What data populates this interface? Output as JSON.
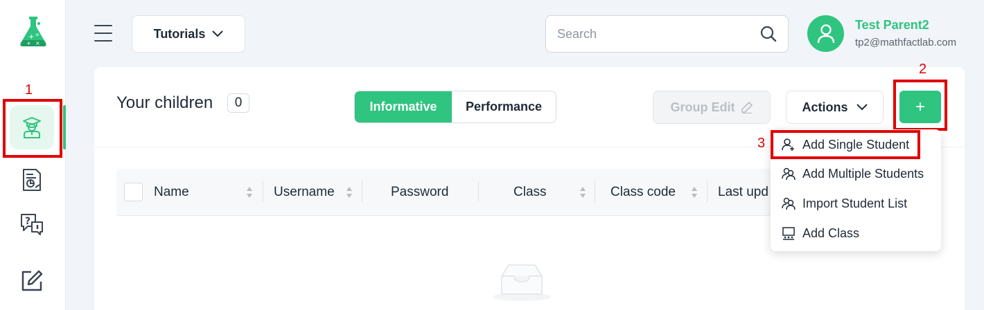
{
  "header": {
    "tutorials_label": "Tutorials",
    "search_placeholder": "Search",
    "user_name": "Test Parent2",
    "user_email": "tp2@mathfactlab.com"
  },
  "card": {
    "title": "Your children",
    "count": "0",
    "tabs": [
      "Informative",
      "Performance"
    ],
    "group_edit_label": "Group Edit",
    "actions_label": "Actions",
    "add_label": "+"
  },
  "table": {
    "columns": [
      "Name",
      "Username",
      "Password",
      "Class",
      "Class code",
      "Last upd"
    ]
  },
  "dropdown": {
    "items": [
      "Add Single Student",
      "Add Multiple Students",
      "Import Student List",
      "Add Class"
    ]
  },
  "annotations": [
    "1",
    "2",
    "3"
  ],
  "colors": {
    "accent": "#2fc47f",
    "annotation": "#e00000"
  }
}
